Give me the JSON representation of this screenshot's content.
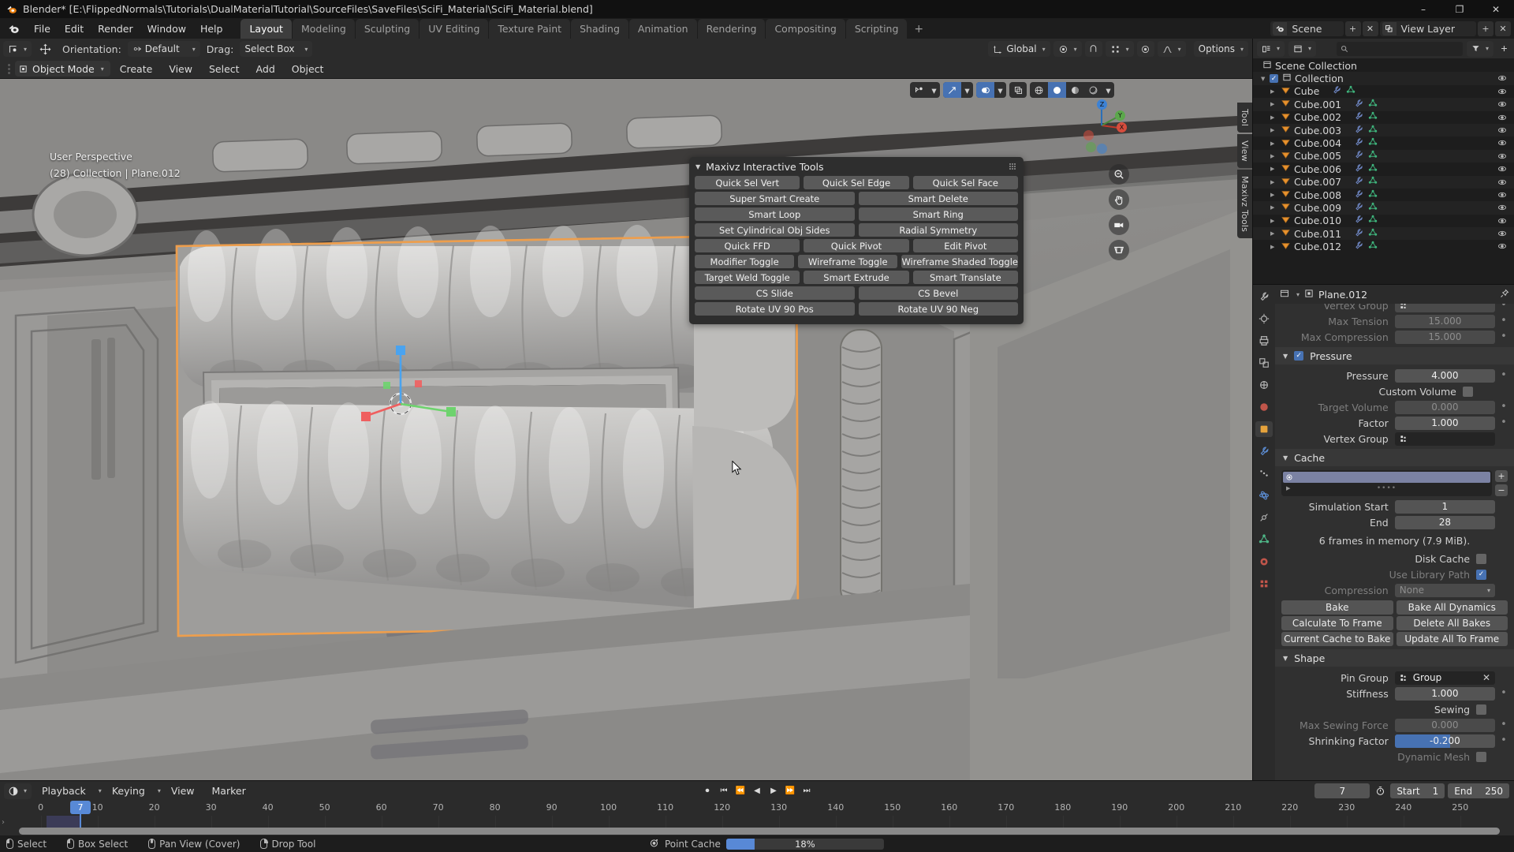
{
  "window": {
    "title": "Blender* [E:\\FlippedNormals\\Tutorials\\DualMaterialTutorial\\SourceFiles\\SaveFiles\\SciFi_Material\\SciFi_Material.blend]",
    "minimize": "–",
    "maximize": "❐",
    "close": "✕"
  },
  "menu": {
    "items": [
      "File",
      "Edit",
      "Render",
      "Window",
      "Help"
    ]
  },
  "workspace_tabs": {
    "items": [
      "Layout",
      "Modeling",
      "Sculpting",
      "UV Editing",
      "Texture Paint",
      "Shading",
      "Animation",
      "Rendering",
      "Compositing",
      "Scripting"
    ],
    "active": "Layout",
    "add_label": "+"
  },
  "topbar_right": {
    "scene_name": "Scene",
    "view_layer_name": "View Layer"
  },
  "tool_header": {
    "orientation_label": "Orientation:",
    "orientation_value": "Default",
    "drag_label": "Drag:",
    "drag_value": "Select Box",
    "transform_space": "Global",
    "options_label": "Options"
  },
  "viewport_header": {
    "mode": "Object Mode",
    "menus": [
      "Create",
      "View",
      "Select",
      "Add",
      "Object"
    ]
  },
  "viewport": {
    "overlay_line1": "User Perspective",
    "overlay_line2": "(28) Collection | Plane.012",
    "gizmo_axes": [
      "X",
      "Y",
      "Z"
    ],
    "side_tabs": [
      "Tool",
      "View",
      "Maxivz Tools"
    ]
  },
  "maxivz_panel": {
    "title": "Maxivz Interactive Tools",
    "rows": [
      [
        "Quick Sel Vert",
        "Quick Sel Edge",
        "Quick Sel Face"
      ],
      [
        "Super Smart Create",
        "Smart Delete"
      ],
      [
        "Smart Loop",
        "Smart Ring"
      ],
      [
        "Set Cylindrical Obj Sides",
        "Radial Symmetry"
      ],
      [
        "Quick FFD",
        "Quick Pivot",
        "Edit Pivot"
      ],
      [
        "Modifier Toggle",
        "Wireframe Toggle",
        "Wireframe Shaded Toggle"
      ],
      [
        "Target Weld Toggle",
        "Smart Extrude",
        "Smart Translate"
      ],
      [
        "CS Slide",
        "CS Bevel"
      ],
      [
        "Rotate UV 90 Pos",
        "Rotate UV 90 Neg"
      ]
    ]
  },
  "outliner": {
    "root": "Scene Collection",
    "collection": "Collection",
    "objects": [
      "Cube",
      "Cube.001",
      "Cube.002",
      "Cube.003",
      "Cube.004",
      "Cube.005",
      "Cube.006",
      "Cube.007",
      "Cube.008",
      "Cube.009",
      "Cube.010",
      "Cube.011",
      "Cube.012"
    ]
  },
  "properties": {
    "breadcrumb_object": "Plane.012",
    "cloth": {
      "vertex_group_hidden_label": "Vertex Group",
      "max_tension_label": "Max Tension",
      "max_tension_value": "15.000",
      "max_compression_label": "Max Compression",
      "max_compression_value": "15.000"
    },
    "pressure": {
      "section": "Pressure",
      "enabled": true,
      "pressure_label": "Pressure",
      "pressure_value": "4.000",
      "custom_volume_label": "Custom Volume",
      "target_volume_label": "Target Volume",
      "target_volume_value": "0.000",
      "factor_label": "Factor",
      "factor_value": "1.000",
      "vertex_group_label": "Vertex Group"
    },
    "cache": {
      "section": "Cache",
      "sim_start_label": "Simulation Start",
      "sim_start_value": "1",
      "end_label": "End",
      "end_value": "28",
      "memory_note": "6 frames in memory (7.9 MiB).",
      "disk_cache_label": "Disk Cache",
      "use_library_path_label": "Use Library Path",
      "compression_label": "Compression",
      "compression_value": "None",
      "buttons": [
        [
          "Bake",
          "Bake All Dynamics"
        ],
        [
          "Calculate To Frame",
          "Delete All Bakes"
        ],
        [
          "Current Cache to Bake",
          "Update All To Frame"
        ]
      ]
    },
    "shape": {
      "section": "Shape",
      "pin_group_label": "Pin Group",
      "pin_group_value": "Group",
      "stiffness_label": "Stiffness",
      "stiffness_value": "1.000",
      "sewing_label": "Sewing",
      "max_sewing_force_label": "Max Sewing Force",
      "max_sewing_force_value": "0.000",
      "shrinking_factor_label": "Shrinking Factor",
      "shrinking_factor_value": "-0.200",
      "dynamic_mesh_label": "Dynamic Mesh"
    }
  },
  "timeline": {
    "menus": [
      "Playback",
      "Keying",
      "View",
      "Marker"
    ],
    "current_frame": "7",
    "start_label": "Start",
    "start_value": "1",
    "end_label": "End",
    "end_value": "250",
    "ticks": [
      0,
      10,
      20,
      30,
      40,
      50,
      60,
      70,
      80,
      90,
      100,
      110,
      120,
      130,
      140,
      150,
      160,
      170,
      180,
      190,
      200,
      210,
      220,
      230,
      240,
      250
    ]
  },
  "statusbar": {
    "items": [
      "Select",
      "Box Select",
      "Pan View (Cover)",
      "Drop Tool"
    ],
    "progress_label": "Point Cache",
    "progress_value": "18%",
    "progress_percent": 18
  },
  "colors": {
    "accent": "#4772b3",
    "playhead": "#5889d6",
    "outliner_object": "#e8922e",
    "mesh_data": "#3fb47c",
    "selection_outline": "#ed9e4d"
  }
}
